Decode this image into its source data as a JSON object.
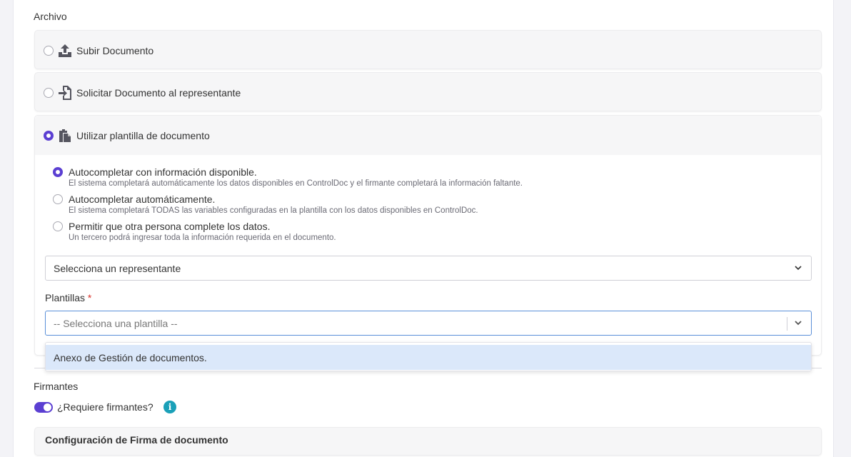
{
  "archivo": {
    "title": "Archivo",
    "options": [
      {
        "label": "Subir Documento",
        "icon": "upload-icon",
        "selected": false
      },
      {
        "label": "Solicitar Documento al representante",
        "icon": "file-import-icon",
        "selected": false
      },
      {
        "label": "Utilizar plantilla de documento",
        "icon": "paste-clipboard-icon",
        "selected": true
      }
    ],
    "template_options": [
      {
        "title": "Autocompletar con información disponible.",
        "desc": "El sistema completará automáticamente los datos disponibles en ControlDoc y el firmante completará la información faltante.",
        "selected": true
      },
      {
        "title": "Autocompletar automáticamente.",
        "desc": "El sistema completará TODAS las variables configuradas en la plantilla con los datos disponibles en ControlDoc.",
        "selected": false
      },
      {
        "title": "Permitir que otra persona complete los datos.",
        "desc": "Un tercero podrá ingresar toda la información requerida en el documento.",
        "selected": false
      }
    ],
    "representante_select": {
      "value": "Selecciona un representante"
    },
    "plantillas": {
      "label": "Plantillas",
      "required_mark": "*",
      "placeholder": "-- Selecciona una plantilla --",
      "dropdown_options": [
        "Anexo de Gestión de documentos."
      ]
    }
  },
  "firmantes": {
    "title": "Firmantes",
    "toggle_label": "¿Requiere firmantes?",
    "toggle_on": true,
    "info_glyph": "i",
    "config_title": "Configuración de Firma de documento"
  },
  "colors": {
    "accent": "#5b3fd2",
    "info": "#1aa0b8",
    "highlight": "#dbe8fa"
  }
}
